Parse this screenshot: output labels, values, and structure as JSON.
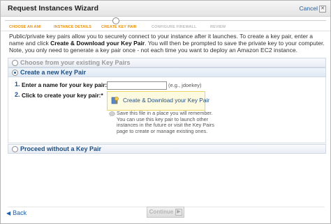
{
  "window": {
    "title": "Request Instances Wizard",
    "cancel_label": "Cancel"
  },
  "steps": [
    {
      "label": "Choose an AMI",
      "state": "done"
    },
    {
      "label": "Instance Details",
      "state": "done"
    },
    {
      "label": "Create Key Pair",
      "state": "current"
    },
    {
      "label": "Configure Firewall",
      "state": "todo"
    },
    {
      "label": "Review",
      "state": "todo"
    }
  ],
  "intro": {
    "part1": "Public/private key pairs allow you to securely connect to your instance after it launches. To create a key pair, enter a name and click ",
    "bold": "Create & Download your Key Pair",
    "part2": ". You will then be prompted to save the private key to your computer. Note, you only need to generate a key pair once - not each time you want to deploy an Amazon EC2 instance."
  },
  "options": {
    "existing": "Choose from your existing Key Pairs",
    "create_new": "Create a new Key Pair",
    "proceed_without": "Proceed without a Key Pair",
    "selected": "create_new"
  },
  "form": {
    "step1_num": "1.",
    "step1_label": "Enter a name for your key pair:*",
    "name_value": "",
    "name_hint": "(e.g., jdoekey)",
    "step2_num": "2.",
    "step2_label": "Click to create your key pair:*",
    "download_button": "Create & Download your Key Pair",
    "save_note": "Save this file in a place you will remember. You can use this key pair to launch other instances in the future or visit the Key Pairs page to create or manage existing ones."
  },
  "footer": {
    "back_label": "Back",
    "continue_label": "Continue"
  },
  "colors": {
    "accent": "#e8900d",
    "link": "#1f5fa8",
    "section_text": "#1f4f85"
  }
}
